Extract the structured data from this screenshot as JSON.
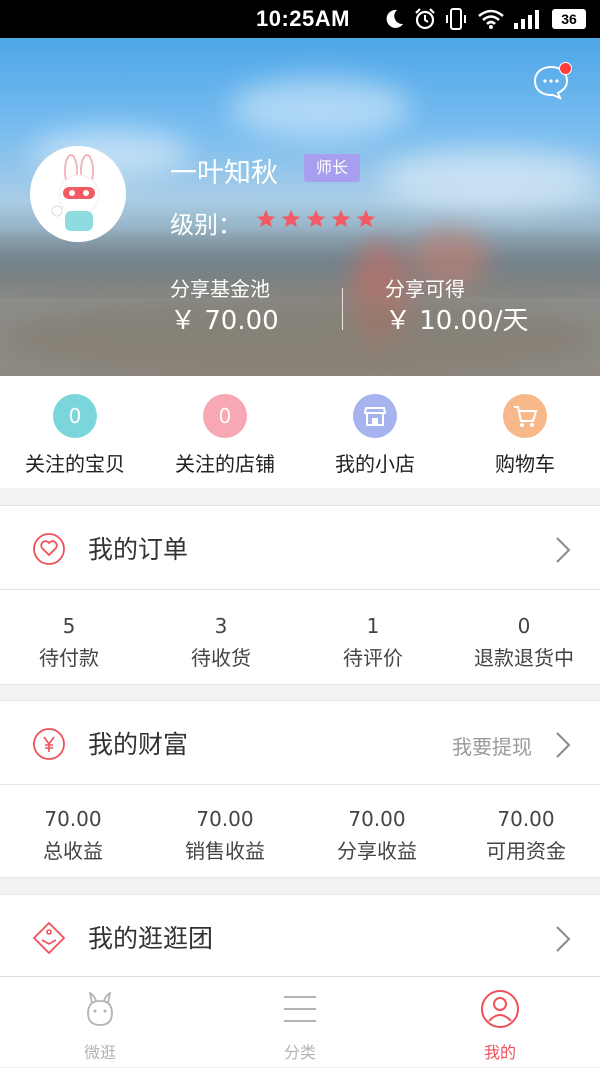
{
  "status_bar": {
    "time": "10:25AM",
    "battery": "36",
    "icons": [
      "moon-icon",
      "alarm-icon",
      "vibrate-icon",
      "wifi-icon",
      "signal-icon",
      "battery-icon"
    ]
  },
  "profile": {
    "name": "一叶知秋",
    "role_badge": "师长",
    "level_label": "级别：",
    "stars": 5,
    "share_pool_label": "分享基金池",
    "share_pool_value": "￥ 70.00",
    "share_earn_label": "分享可得",
    "share_earn_value": "￥ 10.00/天"
  },
  "quick_links": [
    {
      "label": "关注的宝贝",
      "value": "0",
      "color": "#7ad6dc"
    },
    {
      "label": "关注的店铺",
      "value": "0",
      "color": "#f7a8b4"
    },
    {
      "label": "我的小店",
      "value": "",
      "color": "#a7b3ef",
      "icon": "shop-icon"
    },
    {
      "label": "购物车",
      "value": "",
      "color": "#f7b98a",
      "icon": "cart-icon"
    }
  ],
  "orders": {
    "title": "我的订单",
    "stats": [
      {
        "num": "5",
        "label": "待付款"
      },
      {
        "num": "3",
        "label": "待收货"
      },
      {
        "num": "1",
        "label": "待评价"
      },
      {
        "num": "0",
        "label": "退款退货中"
      }
    ]
  },
  "wealth": {
    "title": "我的财富",
    "action": "我要提现",
    "stats": [
      {
        "num": "70.00",
        "label": "总收益"
      },
      {
        "num": "70.00",
        "label": "销售收益"
      },
      {
        "num": "70.00",
        "label": "分享收益"
      },
      {
        "num": "70.00",
        "label": "可用资金"
      }
    ]
  },
  "group": {
    "title": "我的逛逛团"
  },
  "tabs": [
    {
      "label": "微逛",
      "icon": "rabbit-icon"
    },
    {
      "label": "分类",
      "icon": "menu-icon"
    },
    {
      "label": "我的",
      "icon": "profile-icon",
      "active": true
    }
  ],
  "colors": {
    "accent": "#f0505a",
    "badge": "#a79ef0",
    "star": "#f25a64"
  }
}
